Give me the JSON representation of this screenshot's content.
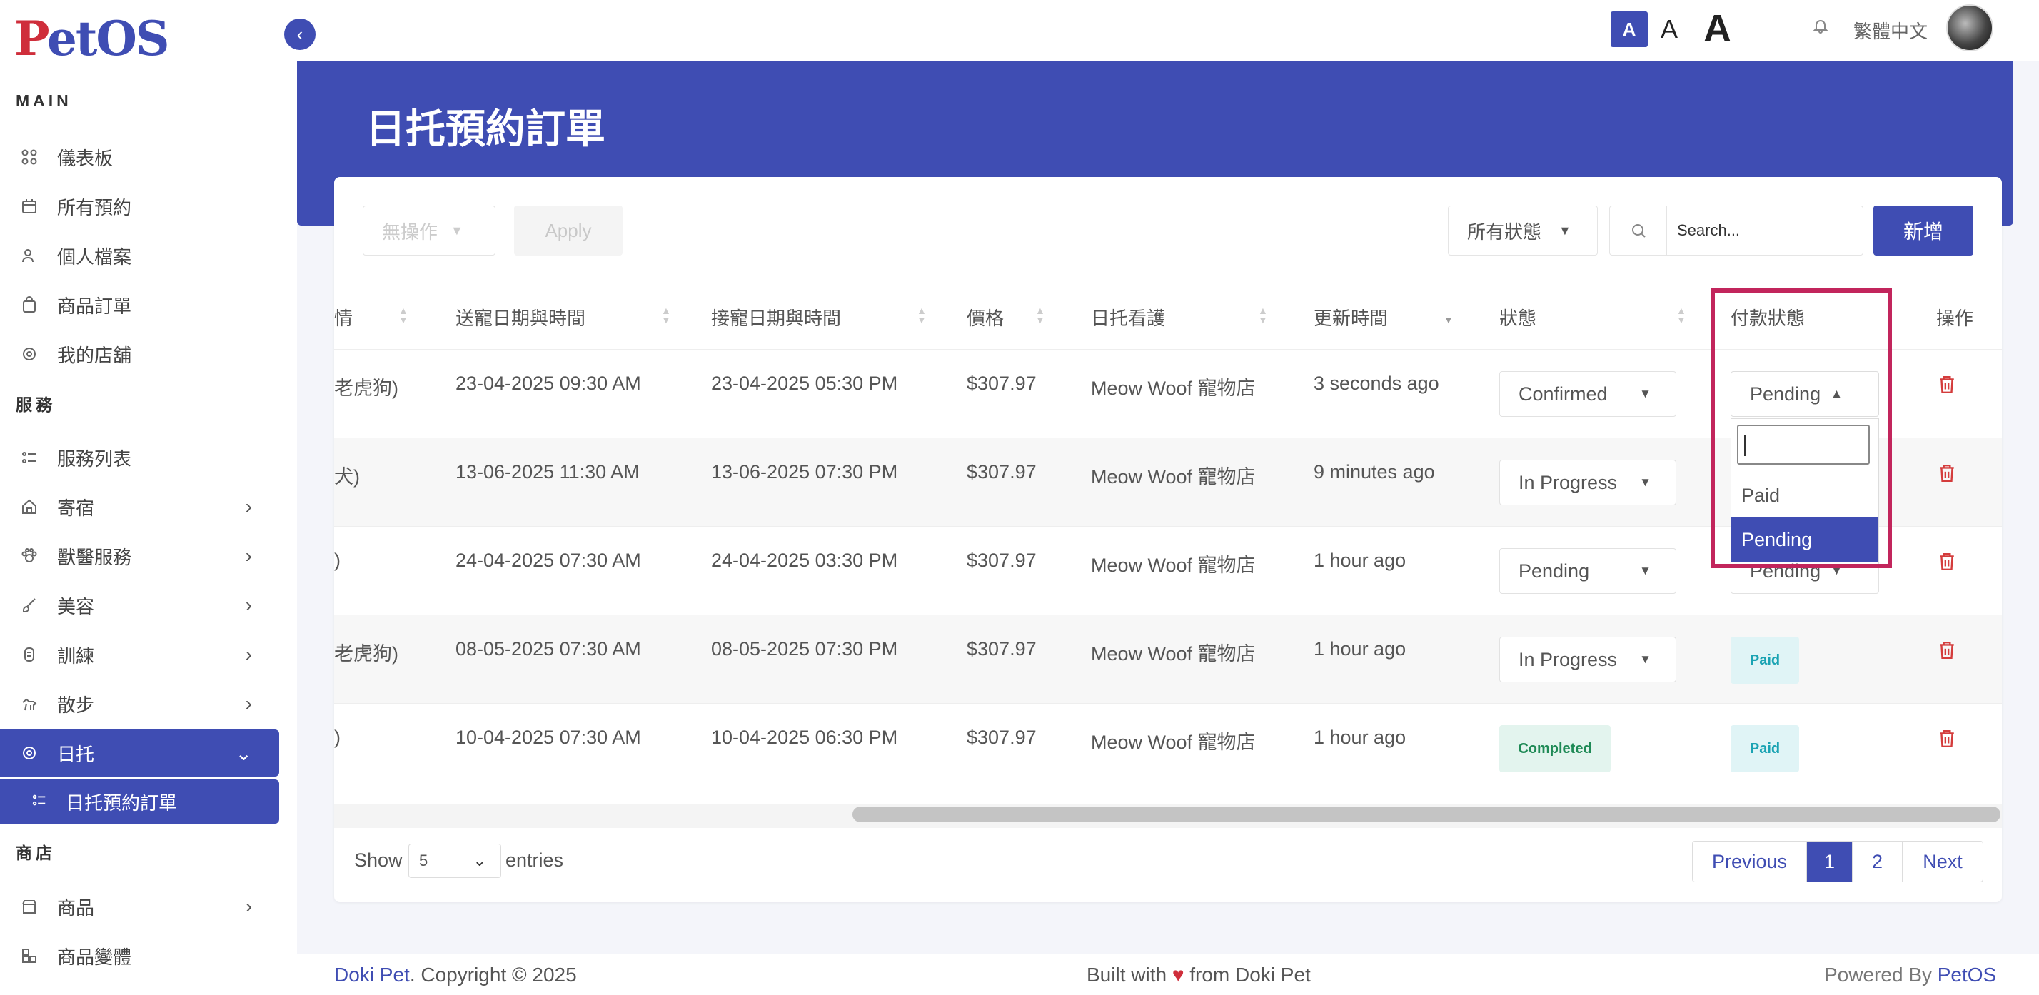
{
  "brand": {
    "logo_p": "P",
    "logo_rest": "etOS"
  },
  "sidebar": {
    "section_main": "MAIN",
    "main_items": [
      {
        "label": "儀表板",
        "icon": "grid-icon"
      },
      {
        "label": "所有預約",
        "icon": "calendar-icon"
      },
      {
        "label": "個人檔案",
        "icon": "user-icon"
      },
      {
        "label": "商品訂單",
        "icon": "bag-icon"
      },
      {
        "label": "我的店舖",
        "icon": "store-icon"
      }
    ],
    "section_service": "服務",
    "service_items": [
      {
        "label": "服務列表",
        "icon": "list-icon"
      },
      {
        "label": "寄宿",
        "icon": "house-icon"
      },
      {
        "label": "獸醫服務",
        "icon": "vet-icon"
      },
      {
        "label": "美容",
        "icon": "brush-icon"
      },
      {
        "label": "訓練",
        "icon": "training-icon"
      },
      {
        "label": "散步",
        "icon": "walk-icon"
      },
      {
        "label": "日托",
        "icon": "daycare-icon"
      }
    ],
    "sub_item": "日托預約訂單",
    "section_shop": "商店",
    "shop_items": [
      {
        "label": "商品",
        "icon": "shop-icon"
      },
      {
        "label": "商品變體",
        "icon": "variant-icon"
      }
    ]
  },
  "topbar": {
    "font_small": "A",
    "font_medium": "A",
    "font_large": "A",
    "language": "繁體中文"
  },
  "page": {
    "title": "日托預約訂單"
  },
  "toolbar": {
    "bulk_action": "無操作",
    "apply": "Apply",
    "status_filter": "所有狀態",
    "search_placeholder": "Search...",
    "new_button": "新增"
  },
  "table": {
    "columns": {
      "pet": "情",
      "dropoff": "送寵日期與時間",
      "pickup": "接寵日期與時間",
      "price": "價格",
      "daycare": "日托看護",
      "updated": "更新時間",
      "status": "狀態",
      "payment": "付款狀態",
      "actions": "操作"
    },
    "rows": [
      {
        "pet": "老虎狗)",
        "dropoff": "23-04-2025 09:30 AM",
        "pickup": "23-04-2025 05:30 PM",
        "price": "$307.97",
        "daycare": "Meow Woof 寵物店",
        "updated": "3 seconds ago",
        "status": "Confirmed",
        "payment": "Pending"
      },
      {
        "pet": "犬)",
        "dropoff": "13-06-2025 11:30 AM",
        "pickup": "13-06-2025 07:30 PM",
        "price": "$307.97",
        "daycare": "Meow Woof 寵物店",
        "updated": "9 minutes ago",
        "status": "In Progress",
        "payment": ""
      },
      {
        "pet": ")",
        "dropoff": "24-04-2025 07:30 AM",
        "pickup": "24-04-2025 03:30 PM",
        "price": "$307.97",
        "daycare": "Meow Woof 寵物店",
        "updated": "1 hour ago",
        "status": "Pending",
        "payment": "Pending"
      },
      {
        "pet": "老虎狗)",
        "dropoff": "08-05-2025 07:30 AM",
        "pickup": "08-05-2025 07:30 PM",
        "price": "$307.97",
        "daycare": "Meow Woof 寵物店",
        "updated": "1 hour ago",
        "status": "In Progress",
        "payment": "Paid"
      },
      {
        "pet": ")",
        "dropoff": "10-04-2025 07:30 AM",
        "pickup": "10-04-2025 06:30 PM",
        "price": "$307.97",
        "daycare": "Meow Woof 寵物店",
        "updated": "1 hour ago",
        "status": "Completed",
        "payment": "Paid"
      }
    ]
  },
  "payment_dropdown": {
    "options": [
      "Paid",
      "Pending"
    ],
    "selected": "Pending"
  },
  "pagination": {
    "show": "Show",
    "entries_value": "5",
    "entries": "entries",
    "previous": "Previous",
    "pages": [
      "1",
      "2"
    ],
    "current": "1",
    "next": "Next"
  },
  "footer": {
    "brand": "Doki Pet",
    "copyright": ". Copyright © 2025",
    "built_with": "Built with",
    "from": "from Doki Pet",
    "powered_by": "Powered By",
    "powered_brand": "PetOS"
  },
  "colors": {
    "primary": "#3f4db3",
    "logo_red": "#cf2e3b",
    "highlight": "#c2255c",
    "danger": "#d43c3c"
  }
}
